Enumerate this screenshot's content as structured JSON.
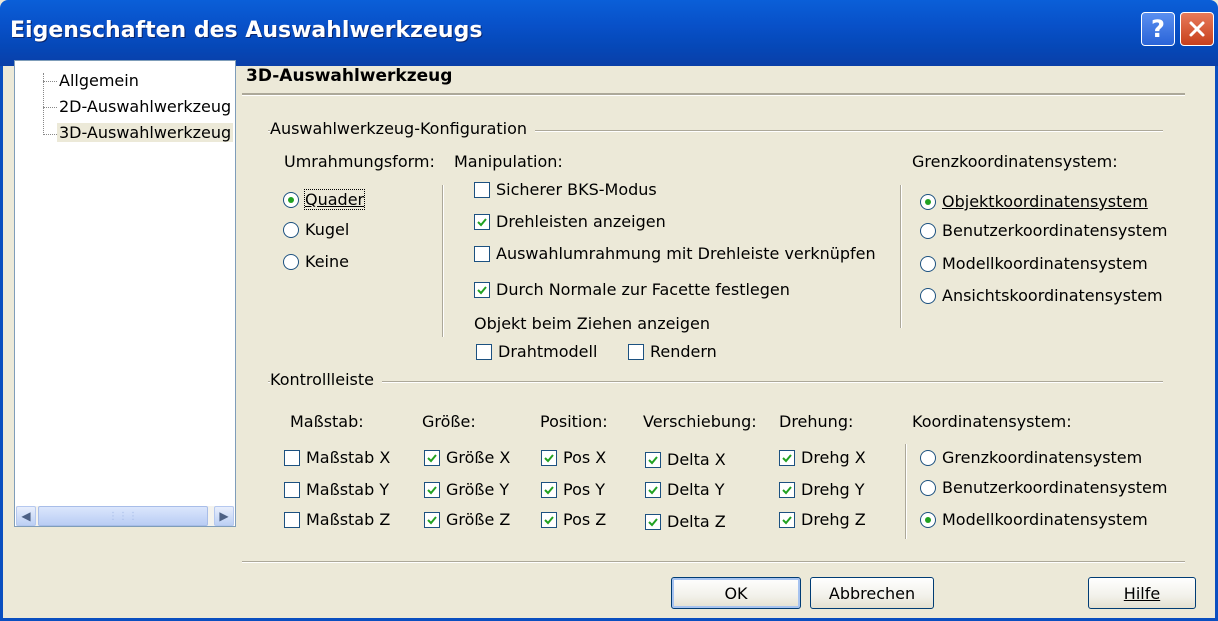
{
  "window": {
    "title": "Eigenschaften des Auswahlwerkzeugs",
    "help_label": "?",
    "close_icon": "close-icon"
  },
  "tree": {
    "items": [
      {
        "label": "Allgemein",
        "selected": false
      },
      {
        "label": "2D-Auswahlwerkzeug",
        "selected": false
      },
      {
        "label": "3D-Auswahlwerkzeug",
        "selected": true
      }
    ]
  },
  "panel": {
    "title": "3D-Auswahlwerkzeug",
    "config": {
      "group_label": "Auswahlwerkzeug-Konfiguration",
      "frame_shape": {
        "label": "Umrahmungsform:",
        "options": [
          {
            "label": "Quader",
            "checked": true
          },
          {
            "label": "Kugel",
            "checked": false
          },
          {
            "label": "Keine",
            "checked": false
          }
        ]
      },
      "manipulation": {
        "label": "Manipulation:",
        "options": [
          {
            "label": "Sicherer BKS-Modus",
            "checked": false
          },
          {
            "label": "Drehleisten anzeigen",
            "checked": true
          },
          {
            "label": "Auswahlumrahmung mit Drehleiste verknüpfen",
            "checked": false
          },
          {
            "label": "Durch Normale zur Facette festlegen",
            "checked": true
          }
        ],
        "drag_label": "Objekt beim Ziehen anzeigen",
        "drag_options": [
          {
            "label": "Drahtmodell",
            "checked": false
          },
          {
            "label": "Rendern",
            "checked": false
          }
        ]
      },
      "boundary_coords": {
        "label": "Grenzkoordinatensystem:",
        "options": [
          {
            "label": "Objektkoordinatensystem",
            "checked": true
          },
          {
            "label": "Benutzerkoordinatensystem",
            "checked": false
          },
          {
            "label": "Modellkoordinatensystem",
            "checked": false
          },
          {
            "label": "Ansichtskoordinatensystem",
            "checked": false
          }
        ]
      }
    },
    "controlbar": {
      "group_label": "Kontrollleiste",
      "scale": {
        "label": "Maßstab:",
        "options": [
          {
            "label": "Maßstab X",
            "checked": false
          },
          {
            "label": "Maßstab Y",
            "checked": false
          },
          {
            "label": "Maßstab Z",
            "checked": false
          }
        ]
      },
      "size": {
        "label": "Größe:",
        "options": [
          {
            "label": "Größe X",
            "checked": true
          },
          {
            "label": "Größe Y",
            "checked": true
          },
          {
            "label": "Größe Z",
            "checked": true
          }
        ]
      },
      "position": {
        "label": "Position:",
        "options": [
          {
            "label": "Pos X",
            "checked": true
          },
          {
            "label": "Pos Y",
            "checked": true
          },
          {
            "label": "Pos Z",
            "checked": true
          }
        ]
      },
      "shift": {
        "label": "Verschiebung:",
        "options": [
          {
            "label": "Delta X",
            "checked": true
          },
          {
            "label": "Delta Y",
            "checked": true
          },
          {
            "label": "Delta Z",
            "checked": true
          }
        ]
      },
      "rotation": {
        "label": "Drehung:",
        "options": [
          {
            "label": "Drehg X",
            "checked": true
          },
          {
            "label": "Drehg Y",
            "checked": true
          },
          {
            "label": "Drehg Z",
            "checked": true
          }
        ]
      },
      "coords": {
        "label": "Koordinatensystem:",
        "options": [
          {
            "label": "Grenzkoordinatensystem",
            "checked": false
          },
          {
            "label": "Benutzerkoordinatensystem",
            "checked": false
          },
          {
            "label": "Modellkoordinatensystem",
            "checked": true
          }
        ]
      }
    }
  },
  "buttons": {
    "ok": "OK",
    "cancel": "Abbrechen",
    "help": "Hilfe"
  },
  "colors": {
    "titlebar": "#0a5fd8",
    "dialog_bg": "#ece9d8",
    "check_mark": "#21a121"
  }
}
